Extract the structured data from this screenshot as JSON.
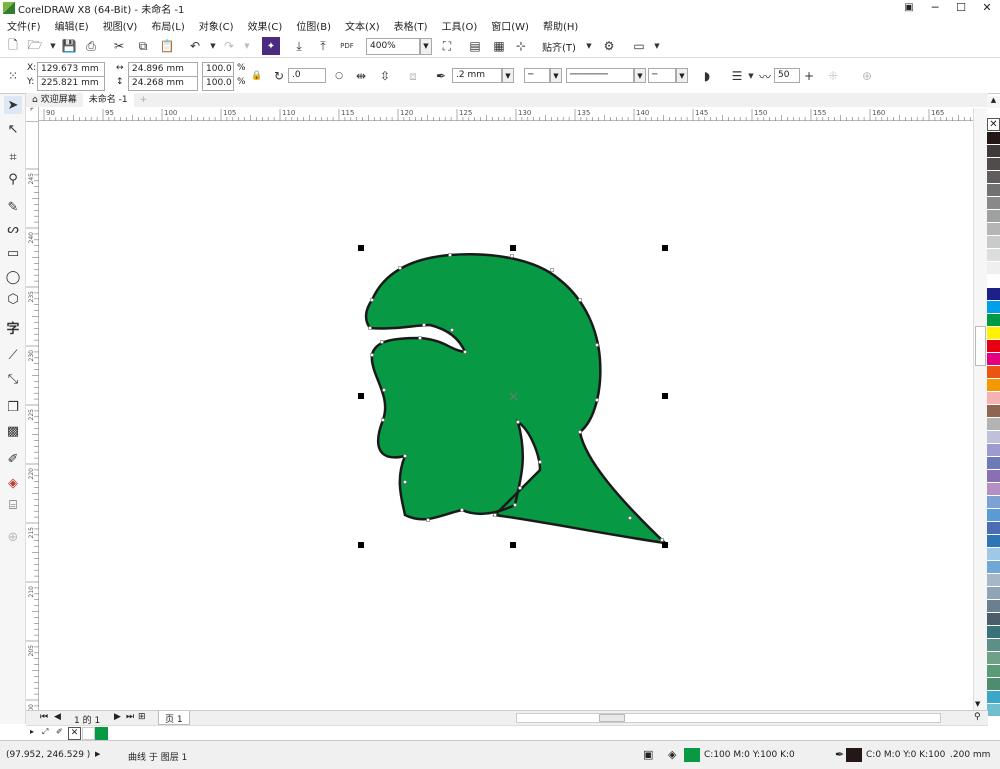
{
  "app": {
    "title": "CorelDRAW X8 (64-Bit) - 未命名 -1",
    "window_buttons": [
      "─",
      "☐",
      "✕"
    ]
  },
  "menu": [
    "文件(F)",
    "编辑(E)",
    "视图(V)",
    "布局(L)",
    "对象(C)",
    "效果(C)",
    "位图(B)",
    "文本(X)",
    "表格(T)",
    "工具(O)",
    "窗口(W)",
    "帮助(H)"
  ],
  "toolbar": {
    "zoom_value": "400%",
    "snap_label": "贴齐(T)",
    "pdf_label": "PDF"
  },
  "property_bar": {
    "x_label": "X:",
    "x_value": "129.673 mm",
    "y_label": "Y:",
    "y_value": "225.821 mm",
    "width_value": "24.896 mm",
    "height_value": "24.268 mm",
    "scale_x": "100.0",
    "scale_y": "100.0",
    "percent": "%",
    "rotation": ".0",
    "outline_width": ".2 mm",
    "smoothing": "50"
  },
  "doc_tabs": {
    "welcome": "欢迎屏幕",
    "document": "未命名 -1"
  },
  "ruler": {
    "h_ticks": [
      "90",
      "95",
      "100",
      "105",
      "110",
      "115",
      "120",
      "125",
      "130",
      "135",
      "140",
      "145",
      "150",
      "155",
      "160",
      "165"
    ],
    "v_ticks": [
      "245",
      "240",
      "235",
      "230",
      "225",
      "220",
      "215",
      "210",
      "205",
      "200"
    ]
  },
  "page_nav": {
    "position": "1 的 1",
    "page_tab": "页 1"
  },
  "status": {
    "cursor_coords": "(97.952, 246.529 )",
    "selection": "曲线 于 图层 1",
    "fill_cmyk": "C:100 M:0 Y:100 K:0",
    "outline_cmyk": "C:0 M:0 Y:0 K:100",
    "outline_width": ".200 mm"
  },
  "colors": {
    "shape_fill": "#079944",
    "shape_outline": "#1a1a1a",
    "outline_swatch": "#231815"
  },
  "palette": [
    "#231815",
    "#3d3a39",
    "#4f4c4b",
    "#605d5c",
    "#727171",
    "#898989",
    "#9fa0a0",
    "#b5b5b6",
    "#c9caca",
    "#dcdddd",
    "#efefef",
    "#ffffff",
    "#1d2088",
    "#00a0e9",
    "#009944",
    "#fff100",
    "#e60012",
    "#e4007f",
    "#ea5514",
    "#f39800",
    "#f5b2b2",
    "#8f6552",
    "#b3b3b3",
    "#c0c0dc",
    "#9b9bd0",
    "#6e7ab8",
    "#8a70b0",
    "#b38fc6",
    "#7ea1d3",
    "#5b9bd5",
    "#4c6cb3",
    "#2e75b6",
    "#9ec8e6",
    "#6fa8d6",
    "#a6b8c8",
    "#8fa5b5",
    "#6a7f8f",
    "#4b5d6a",
    "#39727a",
    "#5d8f87",
    "#70a088",
    "#5a9a74",
    "#4d8c6e",
    "#3aa6c8",
    "#6fbfcf"
  ]
}
